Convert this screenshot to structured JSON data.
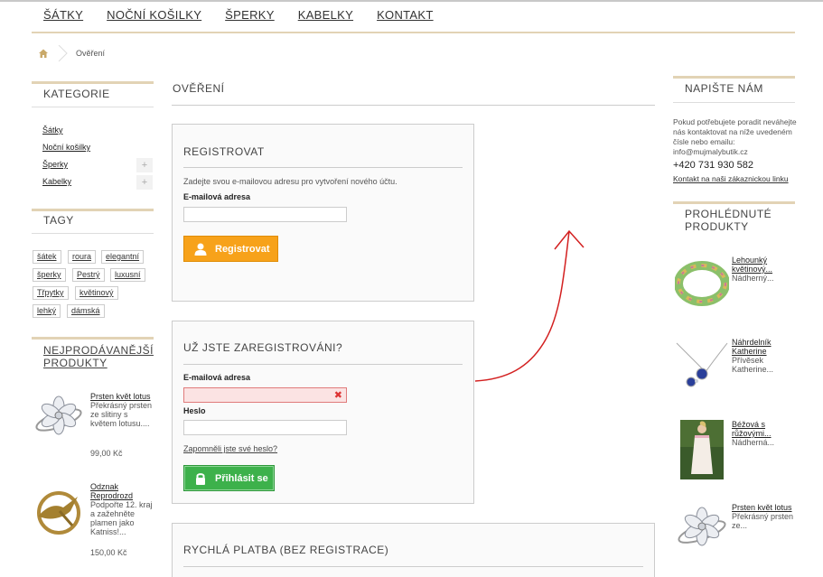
{
  "nav": [
    "ŠÁTKY",
    "NOČNÍ KOŠILKY",
    "ŠPERKY",
    "KABELKY",
    "KONTAKT"
  ],
  "breadcrumb": {
    "current": "Ověření",
    "home_icon": "home-icon"
  },
  "categories": {
    "title": "KATEGORIE",
    "items": [
      {
        "label": "Šátky",
        "expandable": false
      },
      {
        "label": "Noční košilky",
        "expandable": false
      },
      {
        "label": "Šperky",
        "expandable": true
      },
      {
        "label": "Kabelky",
        "expandable": true
      }
    ]
  },
  "tags": {
    "title": "TAGY",
    "items": [
      "šátek",
      "roura",
      "elegantní",
      "šperky",
      "Pestrý",
      "luxusní",
      "Třpytky",
      "květinový",
      "lehký",
      "dámská"
    ]
  },
  "bestsellers": {
    "title": "NEJPRODÁVANĚJŠÍ PRODUKTY",
    "items": [
      {
        "name": "Prsten květ lotus",
        "desc": "Překrásný prsten ze slitiny s květem lotusu....",
        "price": "99,00 Kč"
      },
      {
        "name": "Odznak Reprodrozd",
        "desc": "Podpořte 12. kraj a zažehněte plamen jako Katniss!...",
        "price": "150,00 Kč"
      }
    ]
  },
  "main": {
    "title": "OVĚŘENÍ",
    "register": {
      "title": "REGISTROVAT",
      "hint": "Zadejte svou e-mailovou adresu pro vytvoření nového účtu.",
      "email_label": "E-mailová adresa",
      "email_value": "",
      "button": "Registrovat"
    },
    "login": {
      "title": "UŽ JSTE ZAREGISTROVÁNI?",
      "email_label": "E-mailová adresa",
      "email_value": "",
      "password_label": "Heslo",
      "password_value": "",
      "forgot": "Zapomněli jste své heslo?",
      "button": "Přihlásit se"
    },
    "guest": {
      "title": "RYCHLÁ PLATBA (BEZ REGISTRACE)"
    }
  },
  "contact": {
    "title": "NAPIŠTE NÁM",
    "text": "Pokud potřebujete poradit neváhejte nás kontaktovat na níže uvedeném čísle nebo emailu: info@mujmalybutik.cz",
    "phone": "+420 731 930 582",
    "link": "Kontakt na naši zákaznickou linku"
  },
  "viewed": {
    "title": "PROHLÉDNUTÉ PRODUKTY",
    "items": [
      {
        "name": "Lehounký květinový...",
        "desc": "Nádherný..."
      },
      {
        "name": "Náhrdelník Katherine",
        "desc": "Přívěsek Katherine..."
      },
      {
        "name": "Béžová s růžovými...",
        "desc": "Nádherná..."
      },
      {
        "name": "Prsten květ lotus",
        "desc": "Překrásný prsten ze..."
      }
    ]
  },
  "colors": {
    "accent_line": "#e2d3b5",
    "orange_button": "#f7a21a",
    "green_button": "#3db14b",
    "error": "#d33333",
    "annotation": "#d32020"
  }
}
